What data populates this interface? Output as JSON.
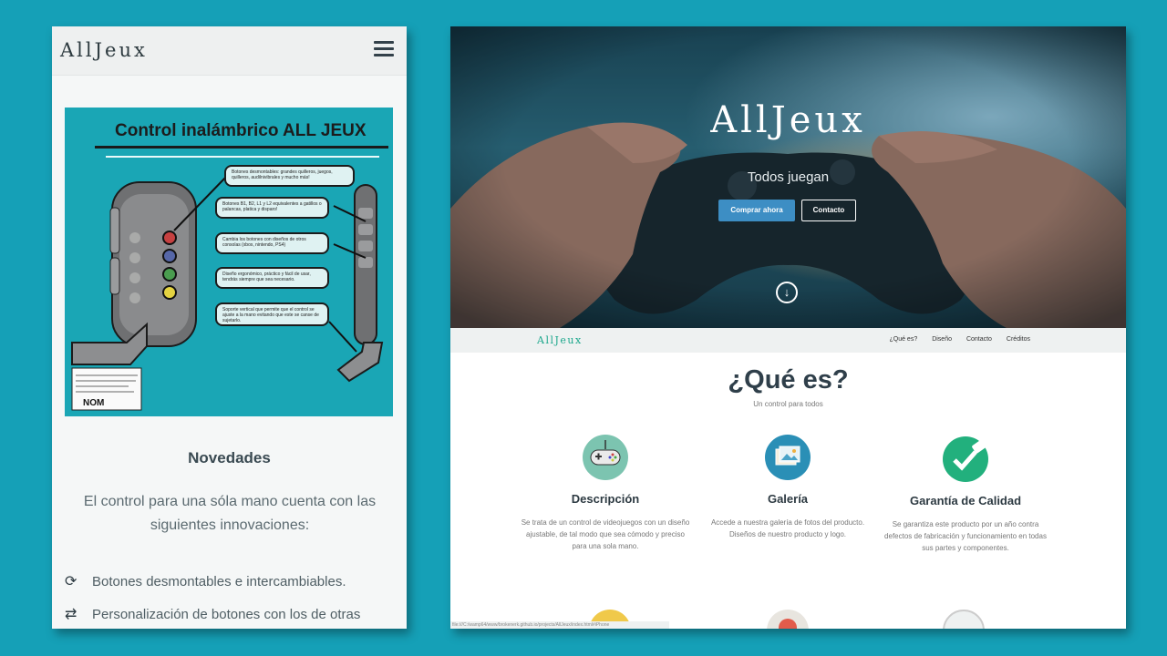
{
  "mobile": {
    "brand": "AllJeux",
    "menu_icon": "hamburger-menu-icon",
    "diagram": {
      "title": "Control inalámbrico ALL JEUX",
      "callouts": [
        "Botones desmontables: grandes quilleros, juegos, quilleros, audilnivibrales y mucho más!",
        "Botones B1, B2, L1 y L2 equivalentes a gatillos o palancas, platica y disparo!",
        "Cambia los botones con diseños de otros consolas (xbox, nintendo, PS4)",
        "Diseño ergonómico, práctico y fácil de usar, tendrás siempre que sea necesario.",
        "Soporte vertical que permite que el control se ajuste a la mano evitando que este se canse de sujetarlo."
      ],
      "label_nom": "NOM"
    },
    "section_title": "Novedades",
    "intro": "El control para una sóla mano cuenta con las siguientes innovaciones:",
    "features": [
      {
        "icon": "refresh-icon",
        "text": "Botones desmontables e intercambiables."
      },
      {
        "icon": "swap-arrows-icon",
        "text": "Personalización de botones con los de otras"
      }
    ]
  },
  "desktop": {
    "hero": {
      "title": "AllJeux",
      "subtitle": "Todos juegan",
      "buy_label": "Comprar ahora",
      "contact_label": "Contacto",
      "scroll_icon": "arrow-down-circle-icon"
    },
    "nav": {
      "brand": "AllJeux",
      "links": [
        "¿Qué es?",
        "Diseño",
        "Contacto",
        "Créditos"
      ]
    },
    "section": {
      "title": "¿Qué es?",
      "subtitle": "Un control para todos"
    },
    "features": [
      {
        "icon": "gamepad-icon",
        "title": "Descripción",
        "text": "Se trata de un control de videojuegos con un diseño ajustable, de tal modo que sea cómodo y preciso para una sola mano.",
        "color": "#7cc4b0"
      },
      {
        "icon": "gallery-icon",
        "title": "Galería",
        "text": "Accede a nuestra galería de fotos del producto. Diseños de nuestro producto y logo.",
        "color": "#2a8fb6"
      },
      {
        "icon": "check-badge-icon",
        "title": "Garantía de Calidad",
        "text": "Se garantiza este producto por un año contra defectos de fabricación y funcionamiento en todas sus partes y componentes.",
        "color": "#22b07d"
      }
    ],
    "status_url": "file:///C:/wamp64/www/brokenerk.github.io/projects/AllJeux/index.html#iPhone"
  },
  "colors": {
    "background": "#15a0b7",
    "accent_green": "#1ca78c",
    "button_blue": "#3d8ec4"
  }
}
